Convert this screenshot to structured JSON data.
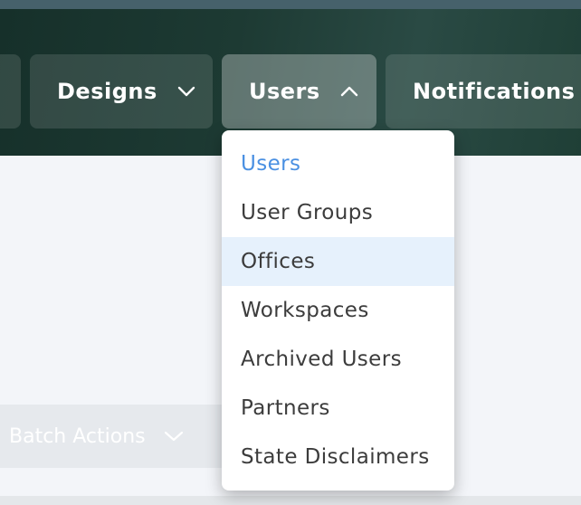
{
  "nav": {
    "items": [
      {
        "label": "",
        "icon": "chevron-down-icon"
      },
      {
        "label": "Designs",
        "icon": "chevron-down-icon"
      },
      {
        "label": "Users",
        "icon": "chevron-up-icon",
        "active": true
      },
      {
        "label": "Notifications",
        "icon": "chevron-down-icon"
      }
    ]
  },
  "dropdown": {
    "items": [
      {
        "label": "Users",
        "state": "current"
      },
      {
        "label": "User Groups"
      },
      {
        "label": "Offices",
        "state": "hovered"
      },
      {
        "label": "Workspaces"
      },
      {
        "label": "Archived Users"
      },
      {
        "label": "Partners"
      },
      {
        "label": "State Disclaimers"
      }
    ]
  },
  "toolbar": {
    "batch_actions_label": "Batch Actions",
    "batch_actions_icon": "chevron-down-icon"
  },
  "colors": {
    "header_dark": "#16302a",
    "header_mid": "#2a4a44",
    "link_blue": "#4a90e2",
    "hover_bg": "#e6f1fc",
    "page_bg": "#f3f5f9"
  }
}
